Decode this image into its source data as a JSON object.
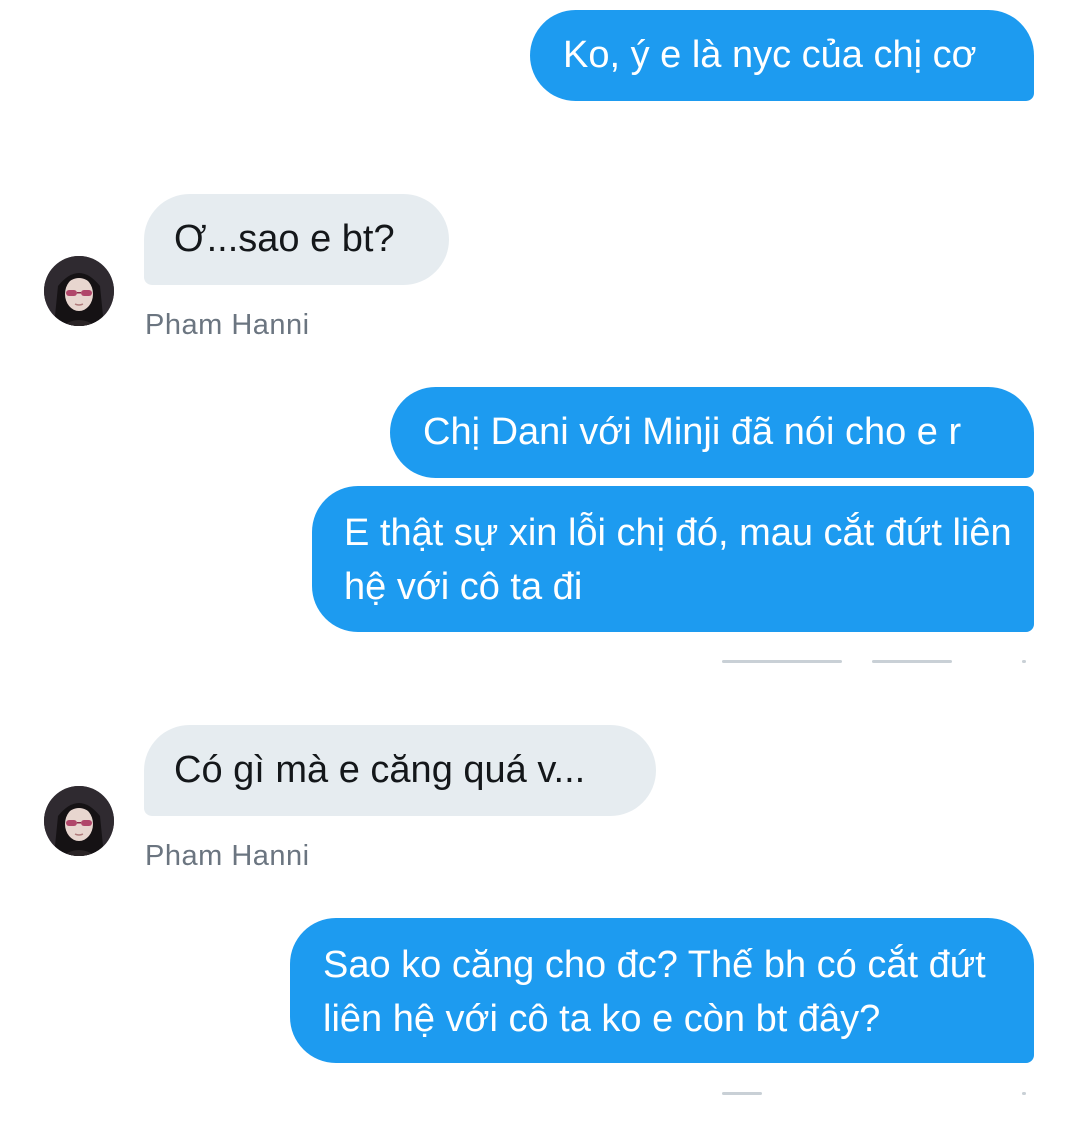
{
  "conversation": {
    "messages": [
      {
        "direction": "out",
        "text": "Ko, ý e là nyc của chị cơ"
      },
      {
        "direction": "in",
        "text": "Ơ...sao e bt?"
      },
      {
        "direction": "out",
        "text": "Chị Dani với Minji đã nói cho e r"
      },
      {
        "direction": "out",
        "text": "E thật sự xin lỗi chị đó, mau cắt đứt liên hệ với cô ta đi"
      },
      {
        "direction": "in",
        "text": "Có gì mà e căng quá v..."
      },
      {
        "direction": "out",
        "text": "Sao ko căng cho đc? Thế bh có cắt đứt liên hệ với cô ta ko e còn bt đây?"
      }
    ],
    "sender_name": "Pham Hanni",
    "colors": {
      "outgoing_bubble": "#1d9bf0",
      "incoming_bubble": "#e6ecf0",
      "sender_name": "#6b7580"
    }
  }
}
